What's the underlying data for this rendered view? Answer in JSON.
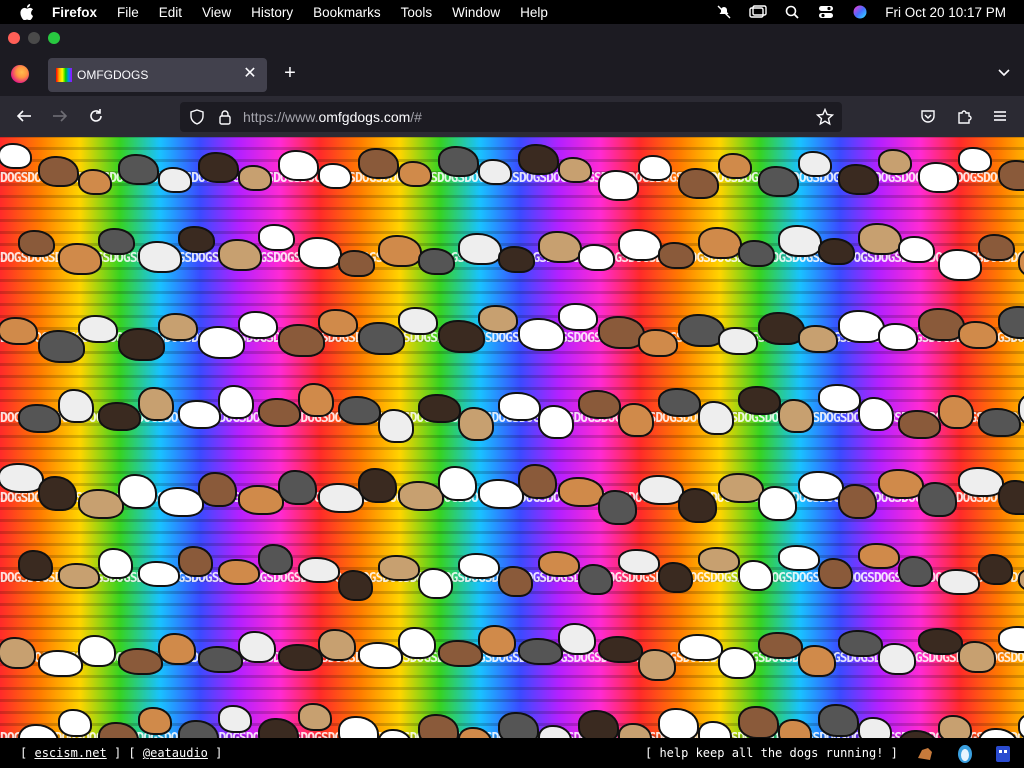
{
  "menubar": {
    "app": "Firefox",
    "items": [
      "File",
      "Edit",
      "View",
      "History",
      "Bookmarks",
      "Tools",
      "Window",
      "Help"
    ],
    "clock": "Fri Oct 20  10:17 PM"
  },
  "tab": {
    "title": "OMFGDOGS"
  },
  "navbar": {
    "url_prefix": "https://www.",
    "url_host": "omfgdogs.com",
    "url_suffix": "/#"
  },
  "content": {
    "band_text": "DOGS",
    "colors": [
      "#ff2a2a",
      "#ff7b00",
      "#ffd400",
      "#36d321",
      "#19c2ff",
      "#3a4bff",
      "#b620ff",
      "#ff2ad4"
    ]
  },
  "footer": {
    "open": "[",
    "link1": "escism.net",
    "sep": "] [",
    "link2": "@eataudio",
    "close": "]",
    "right_text": "[ help keep all the dogs running! ]"
  }
}
